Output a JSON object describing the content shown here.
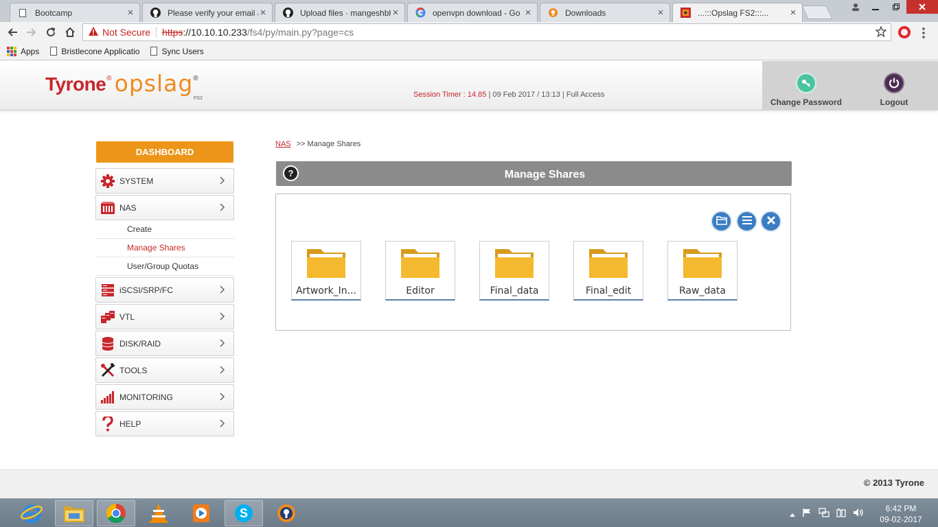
{
  "browser": {
    "tabs": [
      {
        "title": "Bootcamp",
        "close": "×"
      },
      {
        "title": "Please verify your email a",
        "close": "×"
      },
      {
        "title": "Upload files · mangeshbh",
        "close": "×"
      },
      {
        "title": "openvpn download - Go",
        "close": "×"
      },
      {
        "title": "Downloads",
        "close": "×"
      },
      {
        "title": "...:::Opslag FS2:::...",
        "close": "×"
      }
    ],
    "address": {
      "security_label": "Not Secure",
      "scheme": "https",
      "host": "://10.10.10.233",
      "path": "/fs4/py/main.py?page=cs"
    },
    "bookmarks": [
      {
        "label": "Apps"
      },
      {
        "label": "Bristlecone Applicatio"
      },
      {
        "label": "Sync Users"
      }
    ]
  },
  "header": {
    "logo_brand": "Tyrone",
    "logo_product": "opslag",
    "logo_sub": "FS2",
    "session_label": "Session Timer : 14.85",
    "session_info": " | 09 Feb 2017 / 13:13 | Full Access",
    "change_password": "Change Password",
    "logout": "Logout"
  },
  "sidebar": {
    "dashboard": "DASHBOARD",
    "items": [
      {
        "label": "SYSTEM",
        "icon": "gear-icon"
      },
      {
        "label": "NAS",
        "icon": "nas-icon"
      },
      {
        "label": "iSCSI/SRP/FC",
        "icon": "server-icon"
      },
      {
        "label": "VTL",
        "icon": "tape-library-icon"
      },
      {
        "label": "DISK/RAID",
        "icon": "database-icon"
      },
      {
        "label": "TOOLS",
        "icon": "tools-icon"
      },
      {
        "label": "MONITORING",
        "icon": "bar-chart-icon"
      },
      {
        "label": "HELP",
        "icon": "question-icon"
      }
    ],
    "nas_submenu": [
      {
        "label": "Create"
      },
      {
        "label": "Manage Shares"
      },
      {
        "label": "User/Group Quotas"
      }
    ]
  },
  "breadcrumb": {
    "root": "NAS",
    "current": ">> Manage Shares"
  },
  "panel": {
    "title": "Manage Shares",
    "shares": [
      {
        "name": "Artwork_In..."
      },
      {
        "name": "Editor"
      },
      {
        "name": "Final_data"
      },
      {
        "name": "Final_edit"
      },
      {
        "name": "Raw_data"
      }
    ]
  },
  "footer": {
    "copyright": "© 2013 Tyrone"
  },
  "taskbar": {
    "time": "6:42 PM",
    "date": "09-02-2017"
  },
  "colors": {
    "accent_orange": "#ec9519",
    "brand_red": "#c7262c",
    "panel_grey": "#8b8b8b",
    "action_blue": "#3b7ec2"
  }
}
